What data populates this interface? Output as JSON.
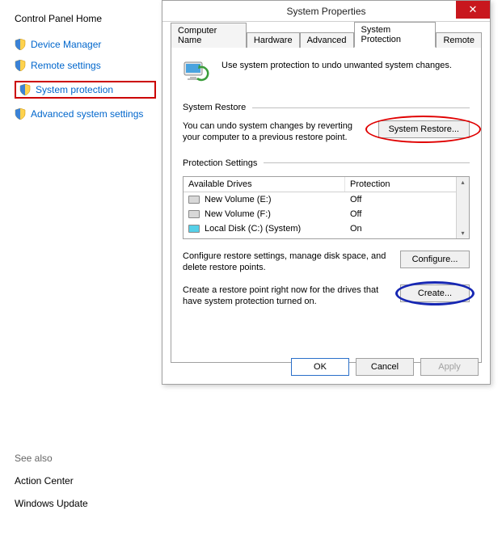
{
  "left": {
    "heading": "Control Panel Home",
    "items": [
      {
        "label": "Device Manager",
        "has_shield": true
      },
      {
        "label": "Remote settings",
        "has_shield": true
      },
      {
        "label": "System protection",
        "has_shield": true,
        "highlighted": true
      },
      {
        "label": "Advanced system settings",
        "has_shield": true
      }
    ]
  },
  "see_also": {
    "heading": "See also",
    "items": [
      "Action Center",
      "Windows Update"
    ]
  },
  "dialog": {
    "title": "System Properties",
    "close_glyph": "✕",
    "tabs": [
      "Computer Name",
      "Hardware",
      "Advanced",
      "System Protection",
      "Remote"
    ],
    "active_tab": "System Protection",
    "intro": "Use system protection to undo unwanted system changes.",
    "restore": {
      "legend": "System Restore",
      "text": "You can undo system changes by reverting your computer to a previous restore point.",
      "button": "System Restore..."
    },
    "protection": {
      "legend": "Protection Settings",
      "col_drive": "Available Drives",
      "col_prot": "Protection",
      "rows": [
        {
          "name": "New Volume (E:)",
          "protection": "Off",
          "icon": "gray"
        },
        {
          "name": "New Volume (F:)",
          "protection": "Off",
          "icon": "gray"
        },
        {
          "name": "Local Disk (C:) (System)",
          "protection": "On",
          "icon": "cyan"
        }
      ],
      "configure_text": "Configure restore settings, manage disk space, and delete restore points.",
      "configure_button": "Configure...",
      "create_text": "Create a restore point right now for the drives that have system protection turned on.",
      "create_button": "Create..."
    },
    "buttons": {
      "ok": "OK",
      "cancel": "Cancel",
      "apply": "Apply"
    }
  }
}
